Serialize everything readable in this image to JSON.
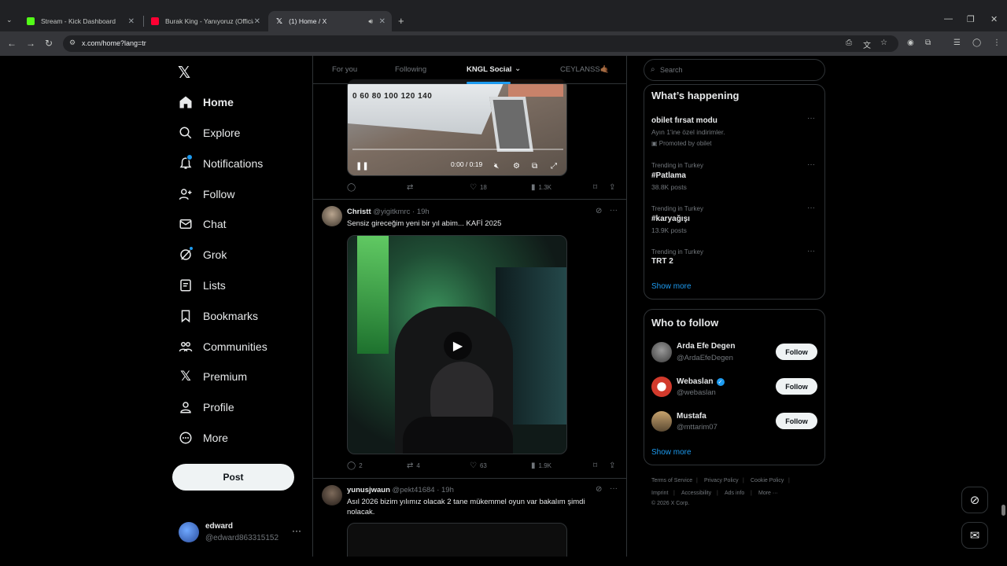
{
  "browser": {
    "tabs": [
      {
        "title": "Stream - Kick Dashboard",
        "color": "#53fc18"
      },
      {
        "title": "Burak King - Yanıyoruz (Official",
        "color": "#ff0033"
      },
      {
        "title": "(1) Home / X",
        "color": "#ffffff"
      }
    ],
    "url": "x.com/home?lang=tr"
  },
  "nav": {
    "items": [
      {
        "label": "Home",
        "icon": "home-icon"
      },
      {
        "label": "Explore",
        "icon": "search-icon"
      },
      {
        "label": "Notifications",
        "icon": "bell-icon"
      },
      {
        "label": "Follow",
        "icon": "person-plus-icon"
      },
      {
        "label": "Chat",
        "icon": "mail-icon"
      },
      {
        "label": "Grok",
        "icon": "grok-icon"
      },
      {
        "label": "Lists",
        "icon": "list-icon"
      },
      {
        "label": "Bookmarks",
        "icon": "bookmark-icon"
      },
      {
        "label": "Communities",
        "icon": "people-icon"
      },
      {
        "label": "Premium",
        "icon": "x-icon"
      },
      {
        "label": "Profile",
        "icon": "person-icon"
      },
      {
        "label": "More",
        "icon": "more-circle-icon"
      }
    ],
    "notification_count": "1",
    "post_label": "Post",
    "user": {
      "name": "edward",
      "handle": "@edward863315152"
    }
  },
  "feed": {
    "tabs": [
      "For you",
      "Following",
      "KNGL Social",
      "CEYLANSS🤙🏾"
    ],
    "tweet1": {
      "gauge_text": "0 60 80 100 120 140",
      "time": "0:00 / 0:19",
      "replies": "",
      "retweets": "",
      "likes": "18",
      "views": "1.3K"
    },
    "tweet2": {
      "name": "Christt",
      "meta": "@yigitkmrc · 19h",
      "text": "Sensiz gireceğim yeni bir yıl abim... KAFİ 2025",
      "replies": "2",
      "retweets": "4",
      "likes": "63",
      "views": "1.9K"
    },
    "tweet3": {
      "name": "yunusjwaun",
      "meta": "@pekt41684 · 19h",
      "text": "Asıl 2026 bizim yılımız olacak 2 tane mükemmel oyun var bakalım şimdi nolacak."
    }
  },
  "sidebar": {
    "search_placeholder": "Search",
    "happening_title": "What’s happening",
    "trends": [
      {
        "context": "",
        "name": "obilet fırsat modu",
        "sub": "Ayın 1'ine özel indirimler.",
        "promo": "Promoted by obilet"
      },
      {
        "context": "Trending in Turkey",
        "name": "#Patlama",
        "sub": "38.8K posts"
      },
      {
        "context": "Trending in Turkey",
        "name": "#karyağışı",
        "sub": "13.9K posts"
      },
      {
        "context": "Trending in Turkey",
        "name": "TRT 2",
        "sub": ""
      }
    ],
    "show_more": "Show more",
    "who_title": "Who to follow",
    "who": [
      {
        "name": "Arda Efe Degen",
        "handle": "@ArdaEfeDegen",
        "follow": "Follow"
      },
      {
        "name": "Webaslan",
        "handle": "@webaslan",
        "follow": "Follow"
      },
      {
        "name": "Mustafa",
        "handle": "@mttarim07",
        "follow": "Follow"
      }
    ],
    "footer": [
      "Terms of Service",
      "Privacy Policy",
      "Cookie Policy",
      "Imprint",
      "Accessibility",
      "Ads info",
      "More ···",
      "© 2026 X Corp."
    ]
  }
}
